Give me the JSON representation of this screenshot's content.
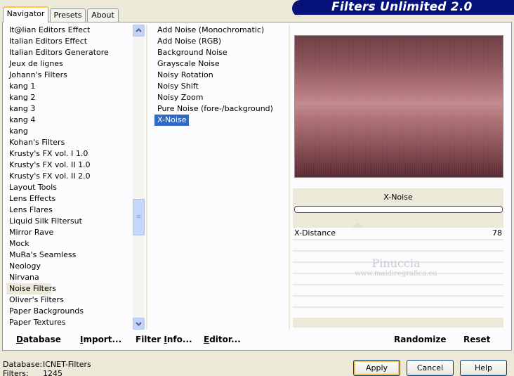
{
  "banner": {
    "title": "Filters Unlimited 2.0"
  },
  "tabs": [
    {
      "label": "Navigator",
      "active": true
    },
    {
      "label": "Presets",
      "active": false
    },
    {
      "label": "About",
      "active": false
    }
  ],
  "categories": {
    "items": [
      "It@lian Editors Effect",
      "Italian Editors Effect",
      "Italian Editors Generatore",
      "Jeux de lignes",
      "Johann's Filters",
      "kang 1",
      "kang 2",
      "kang 3",
      "kang 4",
      "kang",
      "Kohan's Filters",
      "Krusty's FX vol. I 1.0",
      "Krusty's FX vol. II 1.0",
      "Krusty's FX vol. II 2.0",
      "Layout Tools",
      "Lens Effects",
      "Lens Flares",
      "Liquid Silk Filtersut",
      "Mirror Rave",
      "Mock",
      "MuRa's Seamless",
      "Neology",
      "Nirvana",
      "Noise Filters",
      "Oliver's Filters",
      "Paper Backgrounds",
      "Paper Textures"
    ],
    "selected": "Noise Filters"
  },
  "filters": {
    "items": [
      "Add Noise (Monochromatic)",
      "Add Noise (RGB)",
      "Background Noise",
      "Grayscale Noise",
      "Noisy Rotation",
      "Noisy Shift",
      "Noisy Zoom",
      "Pure Noise (fore-/background)",
      "X-Noise"
    ],
    "selected": "X-Noise"
  },
  "params": {
    "filter_name": "X-Noise",
    "sliders": [
      {
        "label": "X-Distance",
        "value": "78"
      }
    ]
  },
  "watermark": {
    "title": "Pinuccia",
    "url": "www.maidiregrafica.eu"
  },
  "links": {
    "database": {
      "u": "D",
      "rest": "atabase"
    },
    "import": {
      "u": "I",
      "rest": "mport..."
    },
    "filter_info": {
      "pre": "Filter ",
      "u": "I",
      "rest": "nfo..."
    },
    "editor": {
      "u": "E",
      "rest": "ditor..."
    },
    "randomize": "Randomize",
    "reset": "Reset"
  },
  "footer": {
    "database_label": "Database:",
    "database_value": "ICNET-Filters",
    "filters_label": "Filters:",
    "filters_value": "1245"
  },
  "buttons": {
    "apply": "Apply",
    "cancel": "Cancel",
    "help": "Help"
  },
  "colors": {
    "banner": "#06117a",
    "selection": "#316ac5"
  }
}
